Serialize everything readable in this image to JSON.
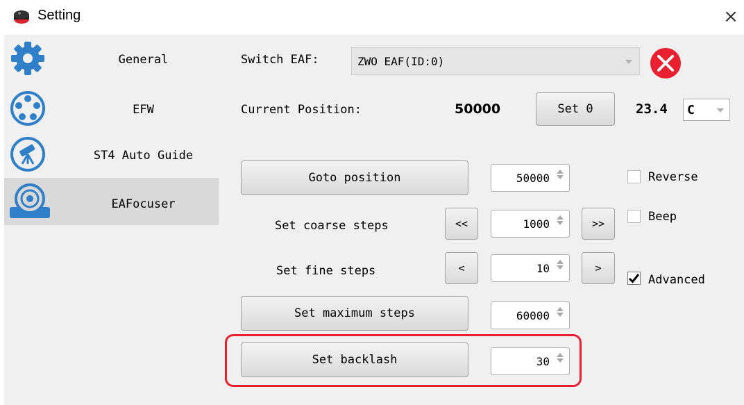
{
  "window": {
    "title": "Setting",
    "close_glyph": "×"
  },
  "sidebar": {
    "items": [
      {
        "label": "General",
        "icon": "gear-icon"
      },
      {
        "label": "EFW",
        "icon": "filter-wheel-icon"
      },
      {
        "label": "ST4 Auto Guide",
        "icon": "telescope-icon"
      },
      {
        "label": "EAFocuser",
        "icon": "focuser-icon",
        "selected": true
      }
    ]
  },
  "main": {
    "switch_eaf_label": "Switch EAF:",
    "switch_eaf_value": "ZWO EAF(ID:0)",
    "current_position_label": "Current Position:",
    "current_position_value": "50000",
    "set0_label": "Set 0",
    "temperature_value": "23.4",
    "temperature_unit": "C",
    "goto_label": "Goto position",
    "goto_value": "50000",
    "coarse_label": "Set coarse steps",
    "coarse_dec": "<<",
    "coarse_value": "1000",
    "coarse_inc": ">>",
    "fine_label": "Set fine steps",
    "fine_dec": "<",
    "fine_value": "10",
    "fine_inc": ">",
    "max_label": "Set maximum steps",
    "max_value": "60000",
    "backlash_label": "Set backlash",
    "backlash_value": "30",
    "reverse_label": "Reverse",
    "reverse_checked": false,
    "beep_label": "Beep",
    "beep_checked": false,
    "advanced_label": "Advanced",
    "advanced_checked": true
  },
  "colors": {
    "accent_red": "#e8202f",
    "highlight_border": "#e8202f",
    "sidebar_icon_blue": "#2f80c8",
    "selected_bg": "#d9d9d9"
  }
}
